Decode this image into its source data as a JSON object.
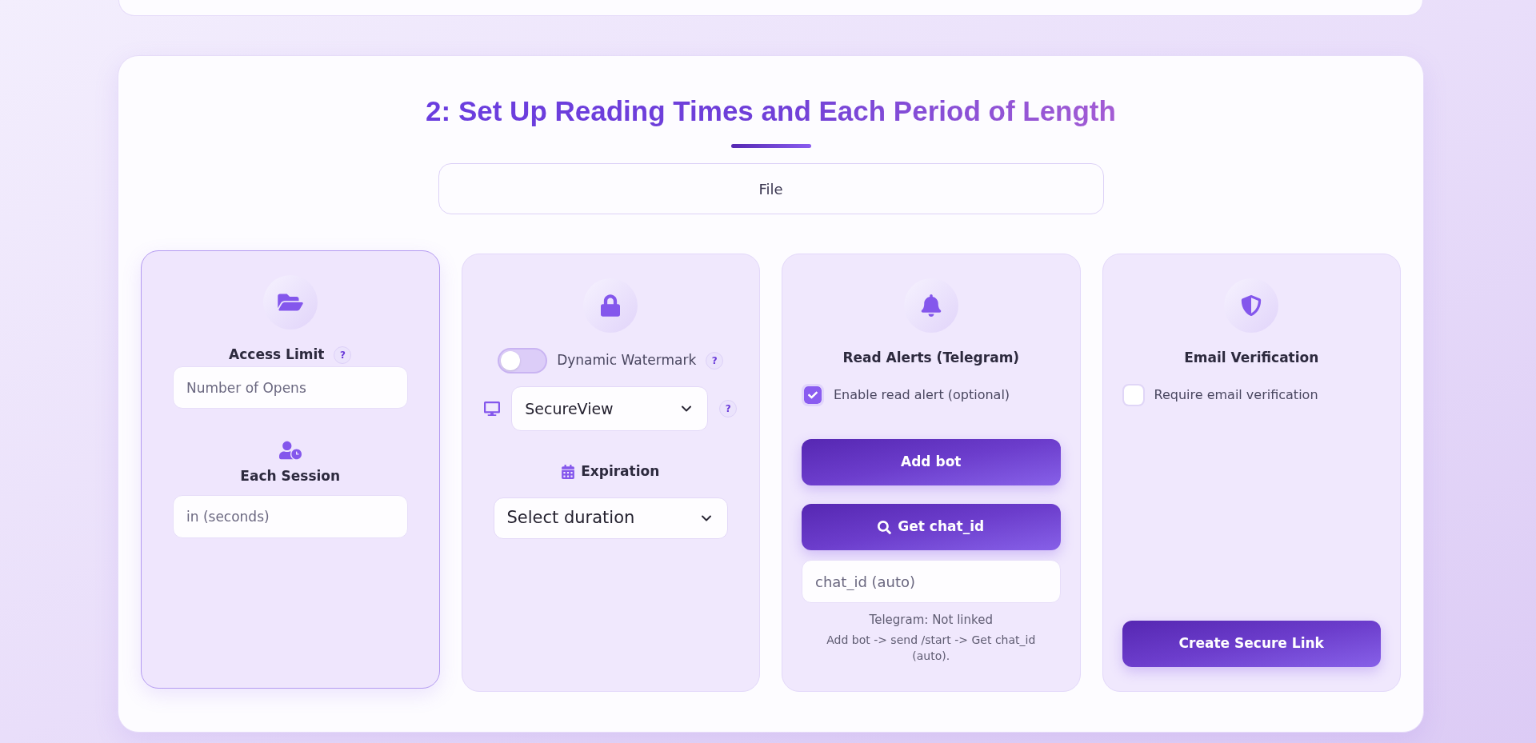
{
  "section": {
    "title": "2: Set Up Reading Times and Each Period of Length",
    "file_label": "File"
  },
  "cards": [
    {
      "kind": "access",
      "highlighted": true,
      "title": "Access Limit",
      "help": "?",
      "opens_field": {
        "placeholder": "Number of Opens"
      },
      "session_title": "Each Session",
      "session_field": {
        "placeholder": "in (seconds)"
      }
    },
    {
      "kind": "watermark",
      "highlighted": false,
      "toggle": {
        "label": "Dynamic Watermark",
        "on": false,
        "help": "?"
      },
      "viewer_select": {
        "value": "SecureView",
        "help": "?"
      },
      "expiration_title": "Expiration",
      "expiration_select": {
        "value": "Select duration"
      }
    },
    {
      "kind": "alerts",
      "highlighted": false,
      "title": "Read Alerts (Telegram)",
      "checkbox": {
        "label": "Enable read alert (optional)",
        "checked": true
      },
      "buttons": [
        {
          "kind": "plain",
          "label": "Add bot"
        },
        {
          "kind": "search",
          "label": "Get chat_id"
        }
      ],
      "chat_field": {
        "placeholder": "chat_id (auto)"
      },
      "status": "Telegram: Not linked",
      "hint": "Add bot -> send /start -> Get chat_id (auto)."
    },
    {
      "kind": "email",
      "highlighted": false,
      "title": "Email Verification",
      "checkbox": {
        "label": "Require email verification",
        "checked": false
      },
      "button": {
        "label": "Create Secure Link"
      }
    }
  ]
}
